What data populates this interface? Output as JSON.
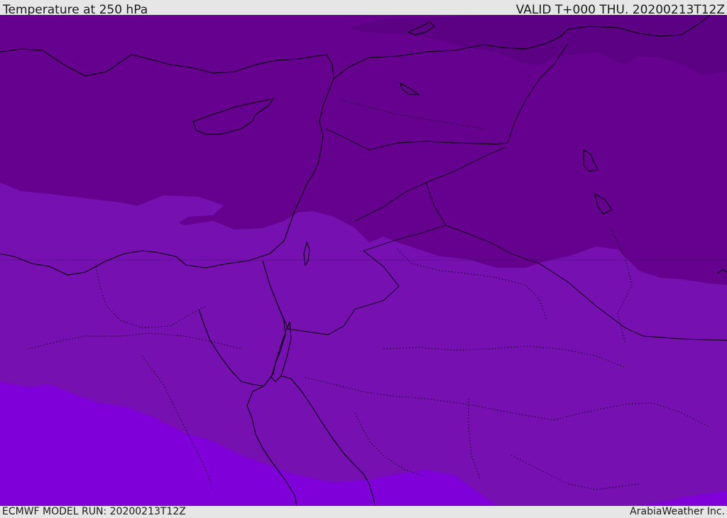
{
  "header": {
    "title": "Temperature at 250 hPa",
    "valid": "VALID T+000 THU. 20200213T12Z"
  },
  "footer": {
    "model_run": "ECMWF MODEL RUN: 20200213T12Z",
    "credit": "ArabiaWeather Inc."
  },
  "map": {
    "colors": {
      "band_darkest": "#5c0084",
      "band_dark": "#66008f",
      "band_mid": "#7610b0",
      "band_bright": "#7f00d9",
      "coastline": "#000000",
      "border": "#000000"
    }
  }
}
